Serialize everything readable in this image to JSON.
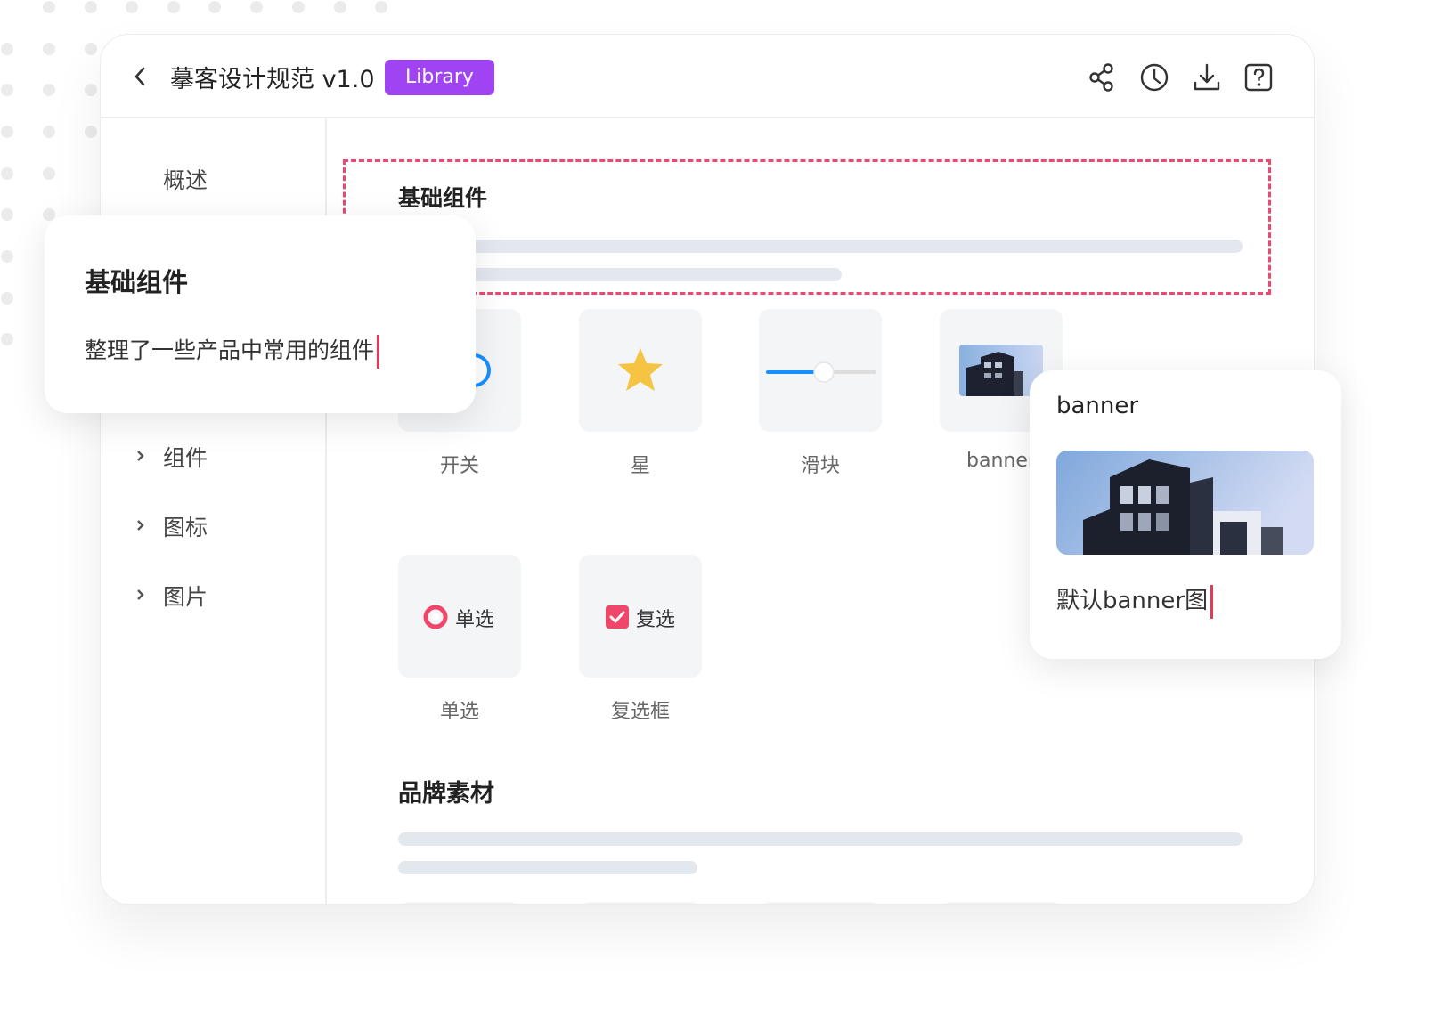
{
  "header": {
    "title": "摹客设计规范 v1.0",
    "badge": "Library",
    "badge_color": "#a044f3",
    "tools": [
      "share-icon",
      "history-icon",
      "download-icon",
      "help-icon"
    ]
  },
  "sidebar": {
    "items": [
      {
        "label": "概述",
        "expandable": false
      },
      {
        "label": "组件",
        "expandable": true
      },
      {
        "label": "图标",
        "expandable": true
      },
      {
        "label": "图片",
        "expandable": true
      }
    ]
  },
  "sections": {
    "basic": {
      "title": "基础组件",
      "components": [
        {
          "label": "开关",
          "icon": "toggle-switch-icon"
        },
        {
          "label": "星",
          "icon": "star-icon"
        },
        {
          "label": "滑块",
          "icon": "slider-icon"
        },
        {
          "label": "banner",
          "icon": "banner-image"
        },
        {
          "label": "单选",
          "icon": "radio-icon",
          "inner_label": "单选"
        },
        {
          "label": "复选框",
          "icon": "checkbox-icon",
          "inner_label": "复选"
        }
      ]
    },
    "brand": {
      "title": "品牌素材"
    }
  },
  "popover_basic": {
    "title": "基础组件",
    "description": "整理了一些产品中常用的组件"
  },
  "popover_banner": {
    "title": "banner",
    "description": "默认banner图"
  },
  "colors": {
    "accent_red": "#ef476f",
    "blue": "#1890ff",
    "star": "#f5c443",
    "checkbox": "#f0466a"
  }
}
